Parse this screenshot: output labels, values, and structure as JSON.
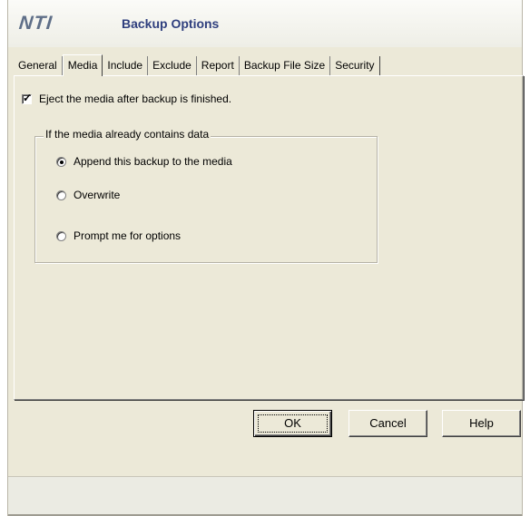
{
  "window": {
    "logo_text": "NTI",
    "title": "Backup Options"
  },
  "tabs": [
    {
      "label": "General",
      "active": false
    },
    {
      "label": "Media",
      "active": true
    },
    {
      "label": "Include",
      "active": false
    },
    {
      "label": "Exclude",
      "active": false
    },
    {
      "label": "Report",
      "active": false
    },
    {
      "label": "Backup File Size",
      "active": false
    },
    {
      "label": "Security",
      "active": false
    }
  ],
  "media": {
    "eject_label": "Eject the media after backup is finished.",
    "eject_checked": true,
    "group_label": "If the media already contains data",
    "options": [
      {
        "label": "Append this backup to the media",
        "selected": true
      },
      {
        "label": "Overwrite",
        "selected": false
      },
      {
        "label": "Prompt me for options",
        "selected": false
      }
    ]
  },
  "buttons": {
    "ok": "OK",
    "cancel": "Cancel",
    "help": "Help"
  },
  "colors": {
    "dialog_bg": "#ece9d8",
    "title_text": "#2f3f7e",
    "logo": "#5f6f88"
  }
}
